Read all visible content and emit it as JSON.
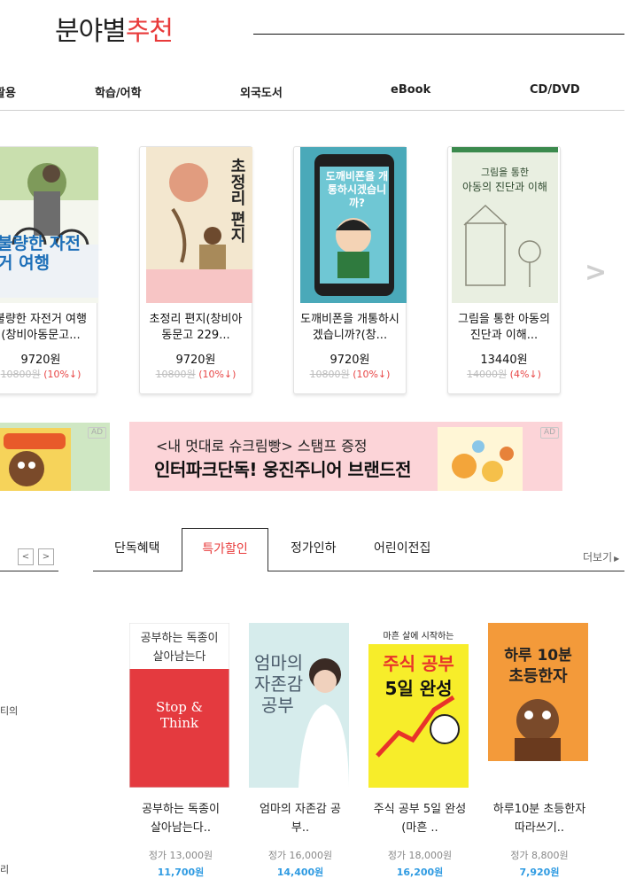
{
  "header": {
    "title_main": "분야별",
    "title_accent": "추천"
  },
  "categories": [
    "활용",
    "학습/어학",
    "외국도서",
    "eBook",
    "CD/DVD"
  ],
  "carousel": {
    "books": [
      {
        "title_l1": "불량한 자전거 여행",
        "title_l2": "(창비아동문고...",
        "price": "9720원",
        "original": "10800원",
        "discount": "(10%↓)",
        "cover_text": "불량한 자전거 여행"
      },
      {
        "title_l1": "초정리 편지(창비아",
        "title_l2": "동문고 229...",
        "price": "9720원",
        "original": "10800원",
        "discount": "(10%↓)",
        "cover_text": "초정리 편지"
      },
      {
        "title_l1": "도깨비폰을 개통하시",
        "title_l2": "겠습니까?(창...",
        "price": "9720원",
        "original": "10800원",
        "discount": "(10%↓)",
        "cover_text": "도깨비폰을 개통하시겠습니까?"
      },
      {
        "title_l1": "그림을 통한 아동의",
        "title_l2": "진단과 이해...",
        "price": "13440원",
        "original": "14000원",
        "discount": "(4%↓)",
        "cover_text_1": "그림을 통한",
        "cover_text_2": "아동의 진단과 이해"
      }
    ],
    "next_arrow": ">"
  },
  "banners": {
    "ad_label": "AD",
    "main_line1": "<내 멋대로 슈크림빵> 스탬프 증정",
    "main_line2": "인터파크단독! 웅진주니어 브랜드전"
  },
  "tabs": {
    "prev": "<",
    "next": ">",
    "items": [
      "단독혜택",
      "특가할인",
      "정가인하",
      "어린이전집"
    ],
    "active": "특가할인",
    "more": "더보기"
  },
  "sale_books": [
    {
      "title_l1": "공부하는 독종이",
      "title_l2": "살아남는다..",
      "list": "정가 13,000원",
      "sale": "11,700원",
      "cover_a": "공부하는 독종이",
      "cover_b": "살아남는다",
      "cover_c": "Stop & Think"
    },
    {
      "title_l1": "엄마의 자존감 공",
      "title_l2": "부..",
      "list": "정가 16,000원",
      "sale": "14,400원",
      "cover_a": "엄마의",
      "cover_b": "자존감",
      "cover_c": "공부"
    },
    {
      "title_l1": "주식 공부 5일 완성",
      "title_l2": "(마흔 ..",
      "list": "정가 18,000원",
      "sale": "16,200원",
      "cover_a": "마흔 살에 시작하는",
      "cover_b": "주식 공부",
      "cover_c": "5일 완성"
    },
    {
      "title_l1": "하루10분 초등한자",
      "title_l2": "따라쓰기..",
      "list": "정가 8,800원",
      "sale": "7,920원",
      "cover_a": "하루 10분",
      "cover_b": "초등한자"
    }
  ],
  "side_fragments": [
    "티의",
    "리"
  ],
  "colors": {
    "accent": "#e83a3a",
    "sale_price": "#2f9be2",
    "discount": "#e84646"
  }
}
